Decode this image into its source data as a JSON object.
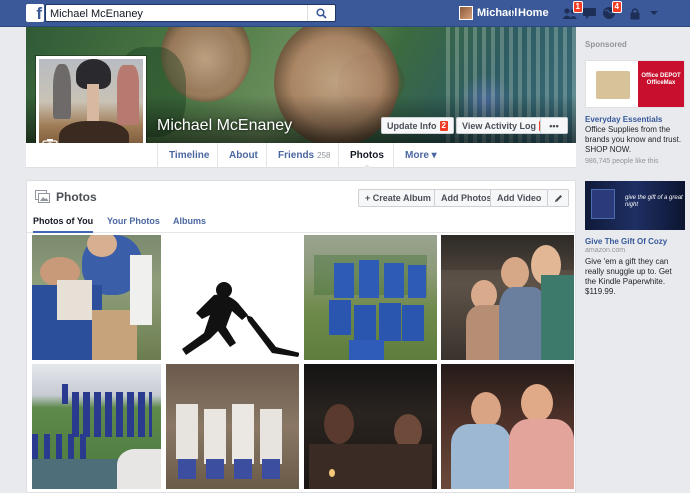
{
  "topbar": {
    "search_value": "Michael McEnaney",
    "user_name": "Michael",
    "home_label": "Home",
    "friend_requests_badge": "1",
    "notifications_badge": "4"
  },
  "profile": {
    "name": "Michael McEnaney",
    "update_info_label": "Update Info",
    "update_info_count": "2",
    "activity_log_label": "View Activity Log",
    "activity_log_count": "9",
    "more_dots": "•••"
  },
  "timeline_nav": {
    "tabs": [
      {
        "label": "Timeline"
      },
      {
        "label": "About"
      },
      {
        "label": "Friends",
        "count": "258"
      },
      {
        "label": "Photos"
      },
      {
        "label": "More ▾"
      }
    ]
  },
  "photos": {
    "title": "Photos",
    "create_album": "+ Create Album",
    "add_photos": "Add Photos",
    "add_video": "Add Video",
    "tabs": [
      {
        "label": "Photos of You"
      },
      {
        "label": "Your Photos"
      },
      {
        "label": "Albums"
      }
    ]
  },
  "sidebar": {
    "sponsored_label": "Sponsored",
    "ad1": {
      "title": "Everyday Essentials",
      "text": "Office Supplies from the brands you know and trust. SHOP NOW.",
      "likes": "986,745 people like this",
      "logo_text": "Office DEPOT OfficeMax"
    },
    "ad2": {
      "title": "Give The Gift Of Cozy",
      "domain": "amazon.com",
      "text": "Give 'em a gift they can really snuggle up to. Get the Kindle Paperwhite. $119.99.",
      "img_text": "give the gift of a great night"
    }
  },
  "colors": {
    "facebook_blue": "#3b5998",
    "link_blue": "#4b67a1",
    "badge_red": "#f03d25"
  }
}
